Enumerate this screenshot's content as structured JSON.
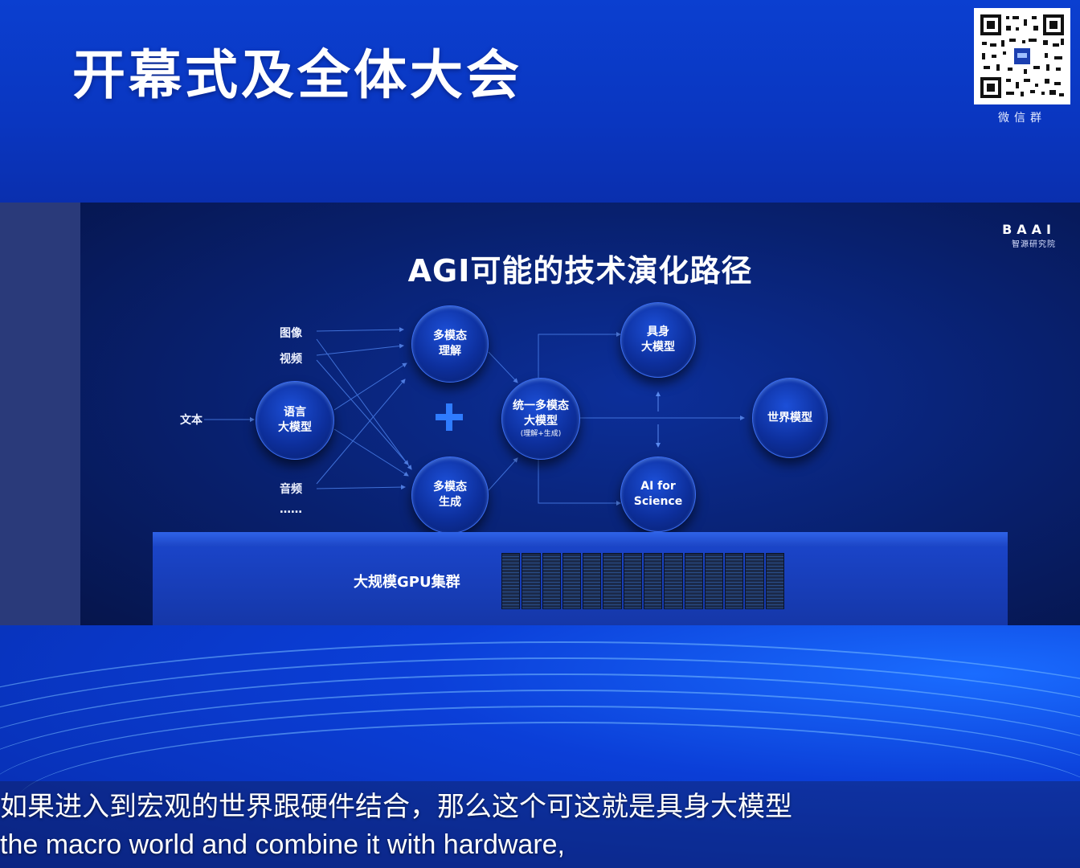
{
  "header": {
    "title": "开幕式及全体大会",
    "qr_label": "微信群"
  },
  "slide": {
    "title": "AGI可能的技术演化路径",
    "logo_text": "BAAI",
    "logo_subtext": "智源研究院",
    "inputs": {
      "image": "图像",
      "video": "视频",
      "text": "文本",
      "audio": "音频",
      "more": "……"
    },
    "nodes": {
      "language_model": [
        "语言",
        "大模型"
      ],
      "mm_understanding": [
        "多模态",
        "理解"
      ],
      "mm_generation": [
        "多模态",
        "生成"
      ],
      "unified_model": [
        "统一多模态",
        "大模型",
        "(理解+生成)"
      ],
      "embodied_model": [
        "具身",
        "大模型"
      ],
      "ai_for_science": [
        "AI for",
        "Science"
      ],
      "world_model": [
        "世界模型"
      ]
    },
    "platform_label": "大规模GPU集群"
  },
  "subtitles": {
    "zh": "如果进入到宏观的世界跟硬件结合，那么这个可这就是具身大模型",
    "en": "the macro world and combine it with hardware,"
  },
  "colors": {
    "background": "#0a2fc2",
    "slide_bg": "#08206e",
    "accent": "#2f7cff",
    "arrow": "#4a7ee8"
  }
}
